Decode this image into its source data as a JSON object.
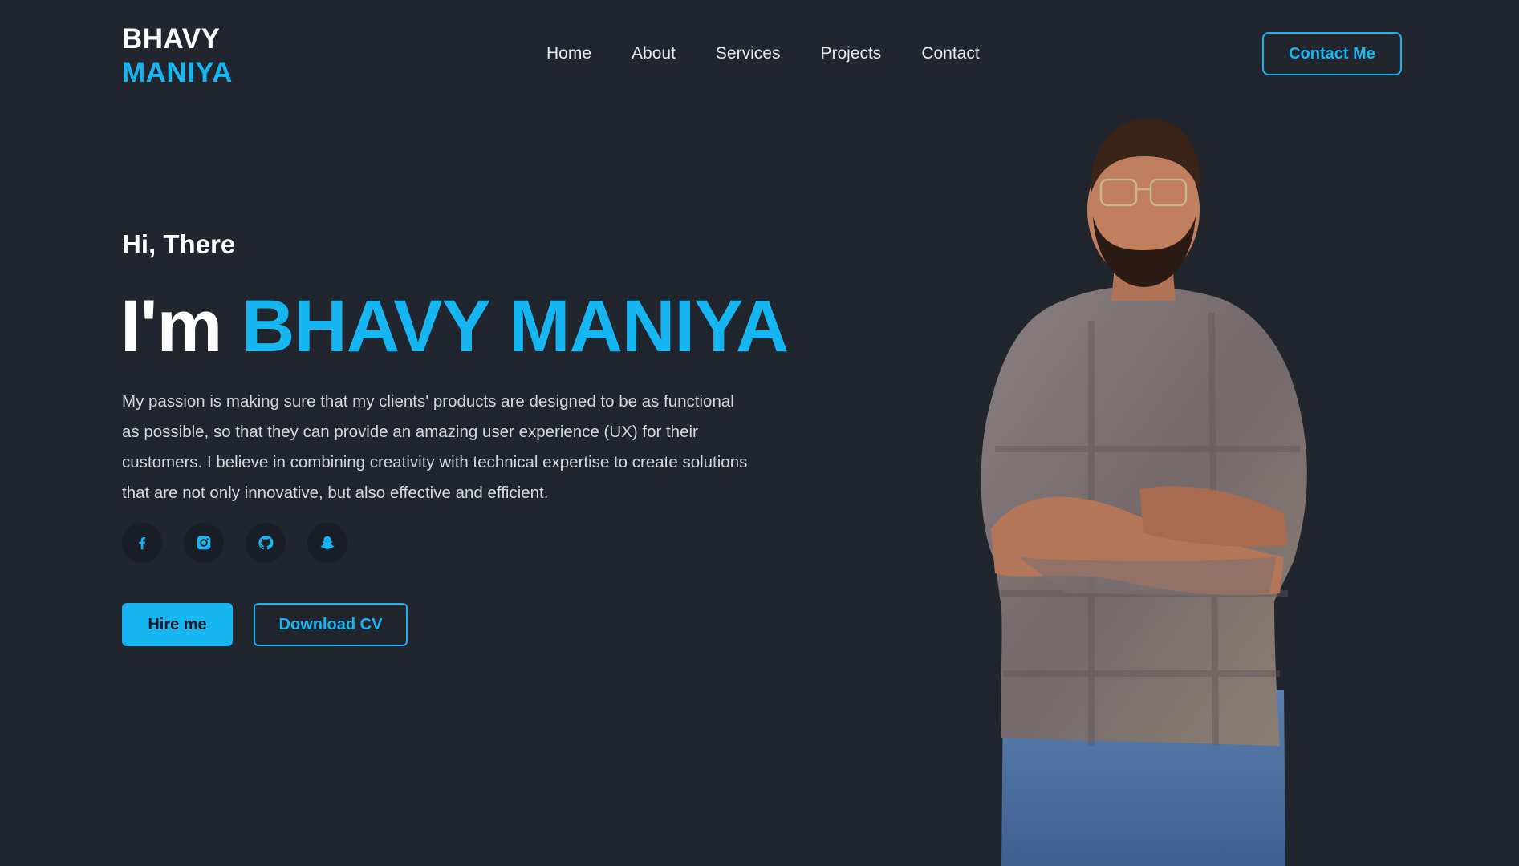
{
  "brand": {
    "line1": "BHAVY",
    "line2": "MANIYA"
  },
  "nav": [
    "Home",
    "About",
    "Services",
    "Projects",
    "Contact"
  ],
  "header": {
    "contact_label": "Contact Me"
  },
  "hero": {
    "greeting": "Hi, There",
    "prefix": "I'm",
    "name": "BHAVY MANIYA",
    "description": "My passion is making sure that my clients' products are designed to be as functional as possible, so that they can provide an amazing user experience (UX) for their customers. I believe in combining creativity with technical expertise to create solutions that are not only innovative, but also effective and efficient.",
    "hire_label": "Hire me",
    "download_label": "Download CV"
  },
  "socials": [
    "facebook-icon",
    "instagram-icon",
    "github-icon",
    "snapchat-icon"
  ],
  "colors": {
    "background": "#20252e",
    "accent": "#16b6f3",
    "text": "#ffffff"
  }
}
